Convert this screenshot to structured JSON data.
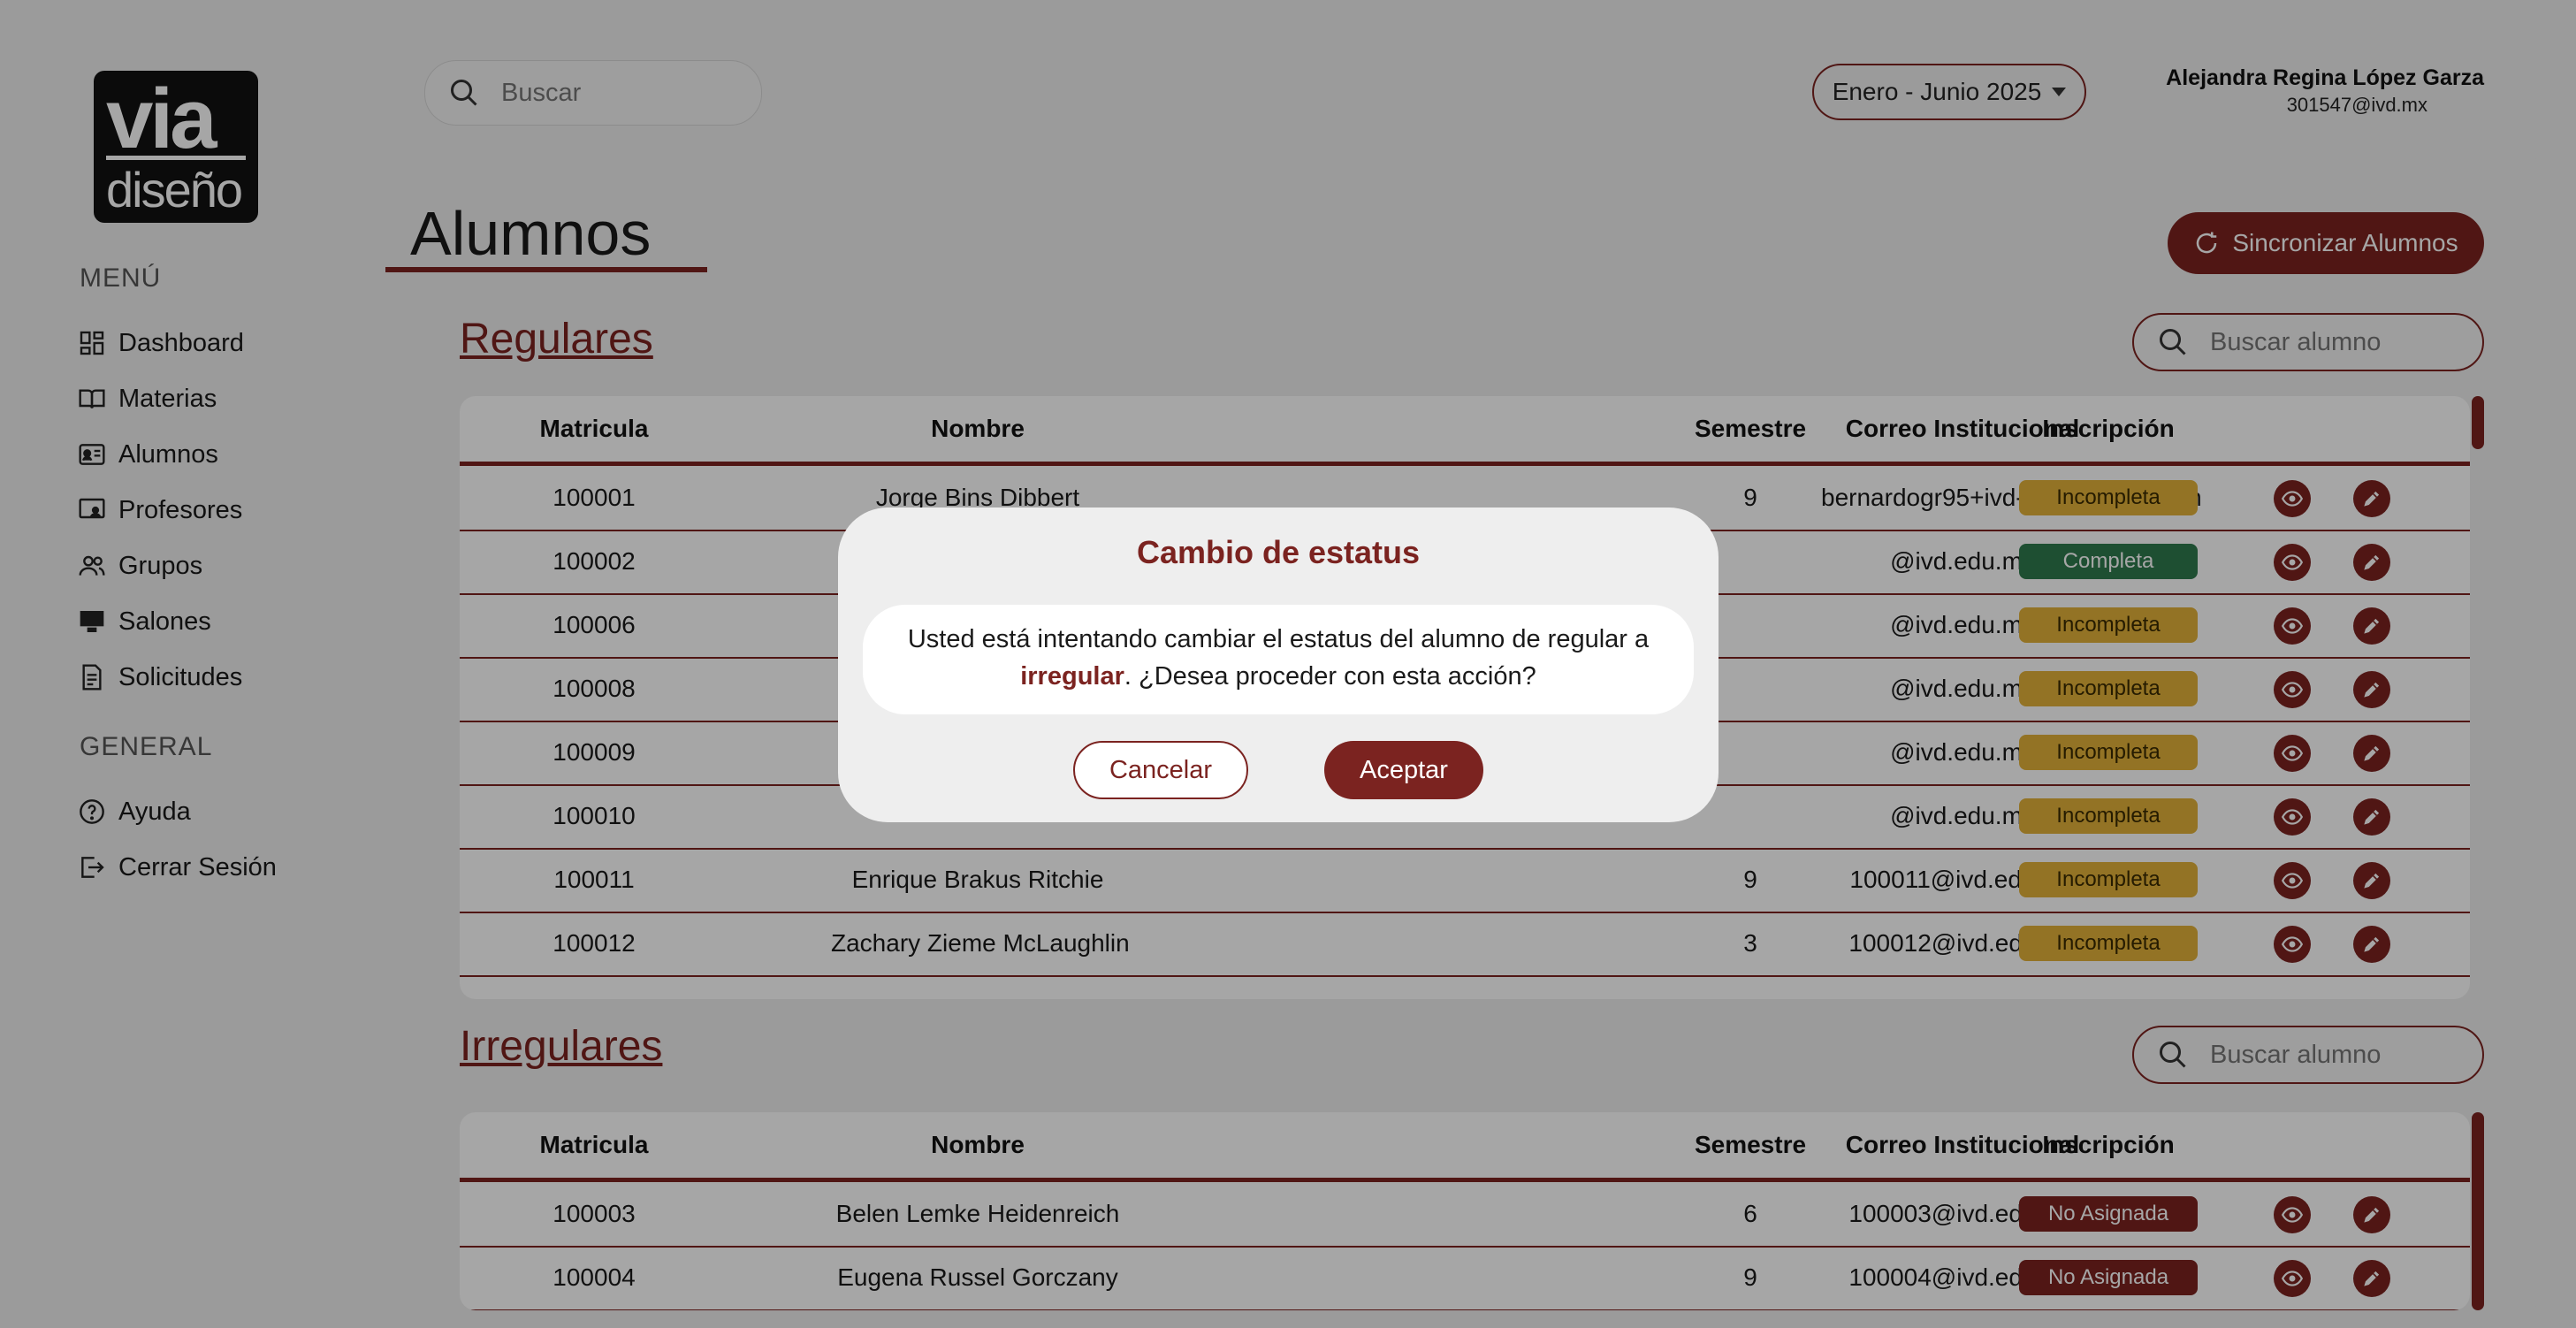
{
  "logo": {
    "top": "via",
    "bottom": "diseño"
  },
  "sidebar": {
    "menu_title": "MENÚ",
    "items": [
      {
        "label": "Dashboard",
        "icon": "dashboard-icon"
      },
      {
        "label": "Materias",
        "icon": "book-icon"
      },
      {
        "label": "Alumnos",
        "icon": "id-card-icon"
      },
      {
        "label": "Profesores",
        "icon": "teacher-icon"
      },
      {
        "label": "Grupos",
        "icon": "users-icon"
      },
      {
        "label": "Salones",
        "icon": "classroom-icon"
      },
      {
        "label": "Solicitudes",
        "icon": "document-icon"
      }
    ],
    "general_title": "GENERAL",
    "general_items": [
      {
        "label": "Ayuda",
        "icon": "help-icon"
      },
      {
        "label": "Cerrar Sesión",
        "icon": "logout-icon"
      }
    ]
  },
  "header": {
    "search_placeholder": "Buscar",
    "period": "Enero - Junio 2025",
    "user_name": "Alejandra Regina López Garza",
    "user_email": "301547@ivd.mx"
  },
  "page": {
    "title": "Alumnos",
    "sync_label": "Sincronizar Alumnos",
    "student_search_placeholder": "Buscar alumno"
  },
  "columns": [
    "Matricula",
    "Nombre",
    "Semestre",
    "Correo Institucional",
    "Inscripción"
  ],
  "regulares": {
    "title": "Regulares",
    "rows": [
      {
        "matricula": "100001",
        "nombre": "Jorge Bins Dibbert",
        "semestre": "9",
        "correo": "bernardogr95+ivd-test@gmail.com",
        "inscripcion": "Incompleta",
        "status": "inc"
      },
      {
        "matricula": "100002",
        "nombre": "",
        "semestre": "",
        "correo": "@ivd.edu.mx",
        "inscripcion": "Completa",
        "status": "com"
      },
      {
        "matricula": "100006",
        "nombre": "",
        "semestre": "",
        "correo": "@ivd.edu.mx",
        "inscripcion": "Incompleta",
        "status": "inc"
      },
      {
        "matricula": "100008",
        "nombre": "",
        "semestre": "",
        "correo": "@ivd.edu.mx",
        "inscripcion": "Incompleta",
        "status": "inc"
      },
      {
        "matricula": "100009",
        "nombre": "",
        "semestre": "",
        "correo": "@ivd.edu.mx",
        "inscripcion": "Incompleta",
        "status": "inc"
      },
      {
        "matricula": "100010",
        "nombre": "",
        "semestre": "",
        "correo": "@ivd.edu.mx",
        "inscripcion": "Incompleta",
        "status": "inc"
      },
      {
        "matricula": "100011",
        "nombre": "Enrique Brakus Ritchie",
        "semestre": "9",
        "correo": "100011@ivd.edu.mx",
        "inscripcion": "Incompleta",
        "status": "inc"
      },
      {
        "matricula": "100012",
        "nombre": "Zachary Zieme McLaughlin",
        "semestre": "3",
        "correo": "100012@ivd.edu.mx",
        "inscripcion": "Incompleta",
        "status": "inc"
      }
    ]
  },
  "irregulares": {
    "title": "Irregulares",
    "rows": [
      {
        "matricula": "100003",
        "nombre": "Belen Lemke Heidenreich",
        "semestre": "6",
        "correo": "100003@ivd.edu.mx",
        "inscripcion": "No Asignada",
        "status": "no"
      },
      {
        "matricula": "100004",
        "nombre": "Eugena Russel Gorczany",
        "semestre": "9",
        "correo": "100004@ivd.edu.mx",
        "inscripcion": "No Asignada",
        "status": "no"
      }
    ]
  },
  "modal": {
    "title": "Cambio de estatus",
    "body_pre": "Usted está intentando cambiar el estatus del alumno de regular a",
    "body_strong": "irregular",
    "body_post": ". ¿Desea proceder con esta acción?",
    "cancel": "Cancelar",
    "accept": "Aceptar"
  },
  "colors": {
    "accent": "#7b2320",
    "incomplete": "#e2b13a",
    "complete": "#2f7a4e"
  }
}
